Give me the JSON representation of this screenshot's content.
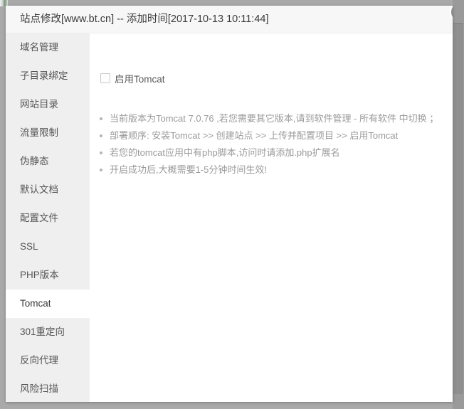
{
  "window": {
    "title": "站点修改[www.bt.cn] -- 添加时间[2017-10-13 10:11:44]",
    "close_icon": "close-icon"
  },
  "sidebar": {
    "items": [
      {
        "label": "域名管理",
        "active": false
      },
      {
        "label": "子目录绑定",
        "active": false
      },
      {
        "label": "网站目录",
        "active": false
      },
      {
        "label": "流量限制",
        "active": false
      },
      {
        "label": "伪静态",
        "active": false
      },
      {
        "label": "默认文档",
        "active": false
      },
      {
        "label": "配置文件",
        "active": false
      },
      {
        "label": "SSL",
        "active": false
      },
      {
        "label": "PHP版本",
        "active": false
      },
      {
        "label": "Tomcat",
        "active": true
      },
      {
        "label": "301重定向",
        "active": false
      },
      {
        "label": "反向代理",
        "active": false
      },
      {
        "label": "风险扫描",
        "active": false
      }
    ]
  },
  "content": {
    "enable_toggle": {
      "label": "启用Tomcat",
      "checked": false
    },
    "notes": [
      "当前版本为Tomcat 7.0.76 ,若您需要其它版本,请到软件管理 - 所有软件 中切换 ；",
      "部署顺序: 安装Tomcat >> 创建站点 >> 上传并配置项目 >> 启用Tomcat",
      "若您的tomcat应用中有php脚本,访问时请添加.php扩展名",
      "开启成功后,大概需要1-5分钟时间生效!"
    ]
  },
  "colors": {
    "dialog_background": "#ffffff",
    "sidebar_background": "#efefef",
    "title_background": "#f7f7f7",
    "page_background": "#a9a9a9",
    "note_text": "#9a9a9a",
    "close_button": "#8d8d8d"
  }
}
